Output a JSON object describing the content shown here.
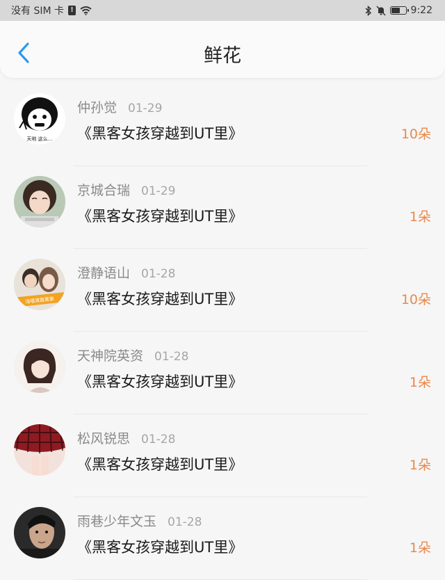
{
  "status_bar": {
    "carrier": "没有 SIM 卡",
    "sim_glyph": "!",
    "time": "9:22"
  },
  "header": {
    "title": "鲜花"
  },
  "colors": {
    "accent_blue": "#2a9af0",
    "flower_orange": "#e8894a"
  },
  "items": [
    {
      "username": "仲孙觉",
      "date": "01-29",
      "book": "《黑客女孩穿越到UT里》",
      "count": "10朵",
      "avatar_text": "天哟 这么…"
    },
    {
      "username": "京城合瑞",
      "date": "01-29",
      "book": "《黑客女孩穿越到UT里》",
      "count": "1朵"
    },
    {
      "username": "澄静语山",
      "date": "01-28",
      "book": "《黑客女孩穿越到UT里》",
      "count": "10朵",
      "avatar_text": "浅唱清宸黑紫"
    },
    {
      "username": "天神院英资",
      "date": "01-28",
      "book": "《黑客女孩穿越到UT里》",
      "count": "1朵"
    },
    {
      "username": "松风锐思",
      "date": "01-28",
      "book": "《黑客女孩穿越到UT里》",
      "count": "1朵"
    },
    {
      "username": "雨巷少年文玉",
      "date": "01-28",
      "book": "《黑客女孩穿越到UT里》",
      "count": "1朵"
    }
  ]
}
